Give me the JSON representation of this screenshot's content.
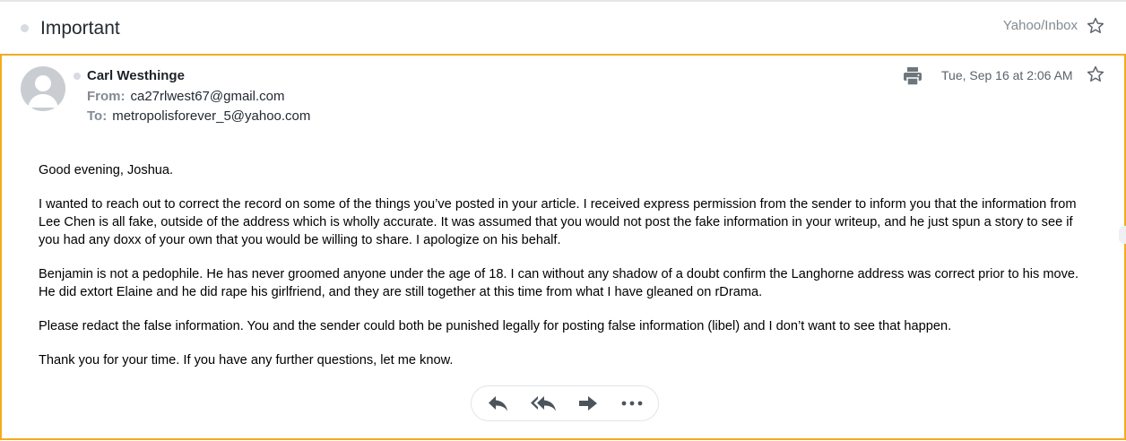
{
  "subject": "Important",
  "folder": "Yahoo/Inbox",
  "message": {
    "sender_name": "Carl Westhinge",
    "from_label": "From:",
    "from_email": "ca27rlwest67@gmail.com",
    "to_label": "To:",
    "to_email": "metropolisforever_5@yahoo.com",
    "date": "Tue, Sep 16 at 2:06 AM"
  },
  "body_paragraphs": [
    "Good evening, Joshua.",
    "I wanted to reach out to correct the record on some of the things you’ve posted in your article. I received express permission from the sender to inform you that the information from Lee Chen is all fake, outside of the address which is wholly accurate. It was assumed that you would not post the fake information in your writeup, and he just spun a story to see if you had any doxx of your own that you would be willing to share. I apologize on his behalf.",
    "Benjamin is not a pedophile. He has never groomed anyone under the age of 18. I can without any shadow of a doubt confirm the Langhorne address was correct prior to his move. He did extort Elaine and he did rape his girlfriend, and they are still together at this time from what I have gleaned on rDrama.",
    "Please redact the false information. You and the sender could both be punished legally for posting false information (libel) and I don’t want to see that happen.",
    "Thank you for your time. If you have any further questions, let me know."
  ],
  "icons": {
    "star": "star-outline-icon",
    "print": "printer-icon",
    "reply": "reply-icon",
    "reply_all": "reply-all-icon",
    "forward": "forward-icon",
    "more": "more-icon"
  },
  "colors": {
    "accent_border": "#f4ab1d",
    "muted_text": "#828a93",
    "icon": "#5b636a"
  }
}
